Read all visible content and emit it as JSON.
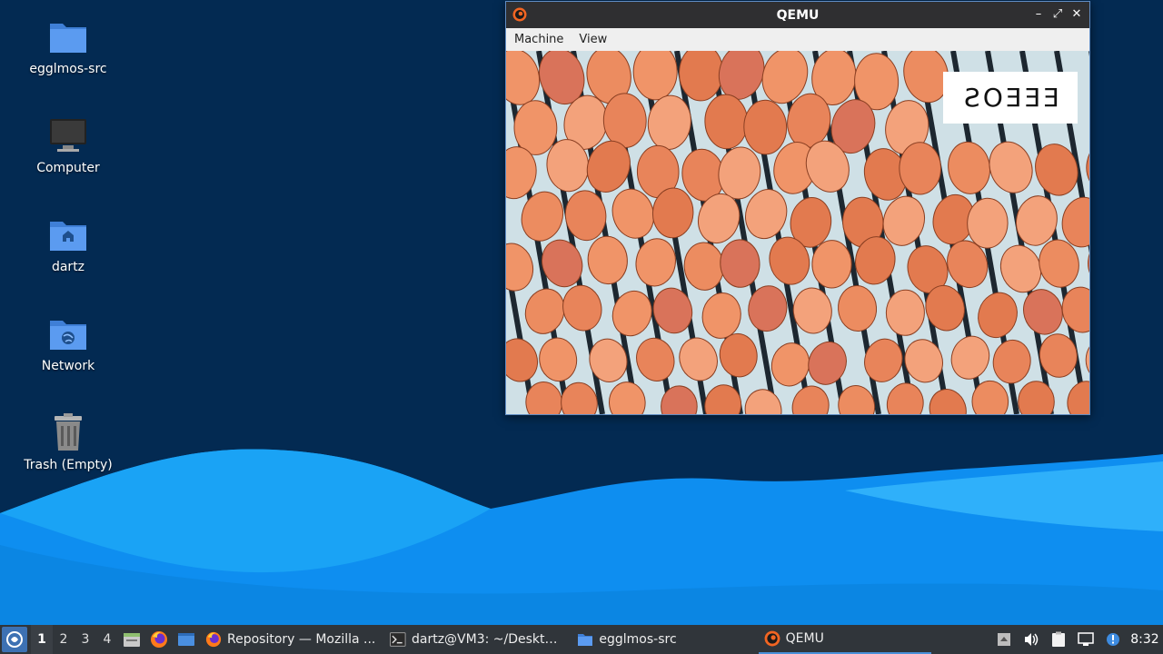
{
  "desktop": {
    "icons": [
      {
        "label": "egglmos-src",
        "icon": "folder-icon"
      },
      {
        "label": "Computer",
        "icon": "computer-icon"
      },
      {
        "label": "dartz",
        "icon": "home-folder-icon"
      },
      {
        "label": "Network",
        "icon": "network-folder-icon"
      },
      {
        "label": "Trash (Empty)",
        "icon": "trash-icon"
      }
    ]
  },
  "qemu": {
    "title": "QEMU",
    "menu": [
      "Machine",
      "View"
    ],
    "guest_sign_text": "EEEOS",
    "controls": {
      "minimize": "–",
      "maximize": "⤢",
      "close": "✕"
    }
  },
  "taskbar": {
    "workspaces": [
      "1",
      "2",
      "3",
      "4"
    ],
    "active_workspace": "1",
    "tasks": [
      {
        "label": "Repository — Mozilla ...",
        "icon": "firefox-icon"
      },
      {
        "label": "dartz@VM3: ~/Deskto...",
        "icon": "terminal-icon"
      },
      {
        "label": "egglmos-src",
        "icon": "folder-icon"
      },
      {
        "label": "QEMU",
        "icon": "qemu-icon"
      }
    ],
    "clock": "8:32"
  },
  "colors": {
    "wallpaper_dark": "#032a52",
    "wave_light": "#1d9bf0",
    "wave_mid": "#0b86e0",
    "taskbar": "#30353a",
    "accent": "#3d71b3"
  }
}
